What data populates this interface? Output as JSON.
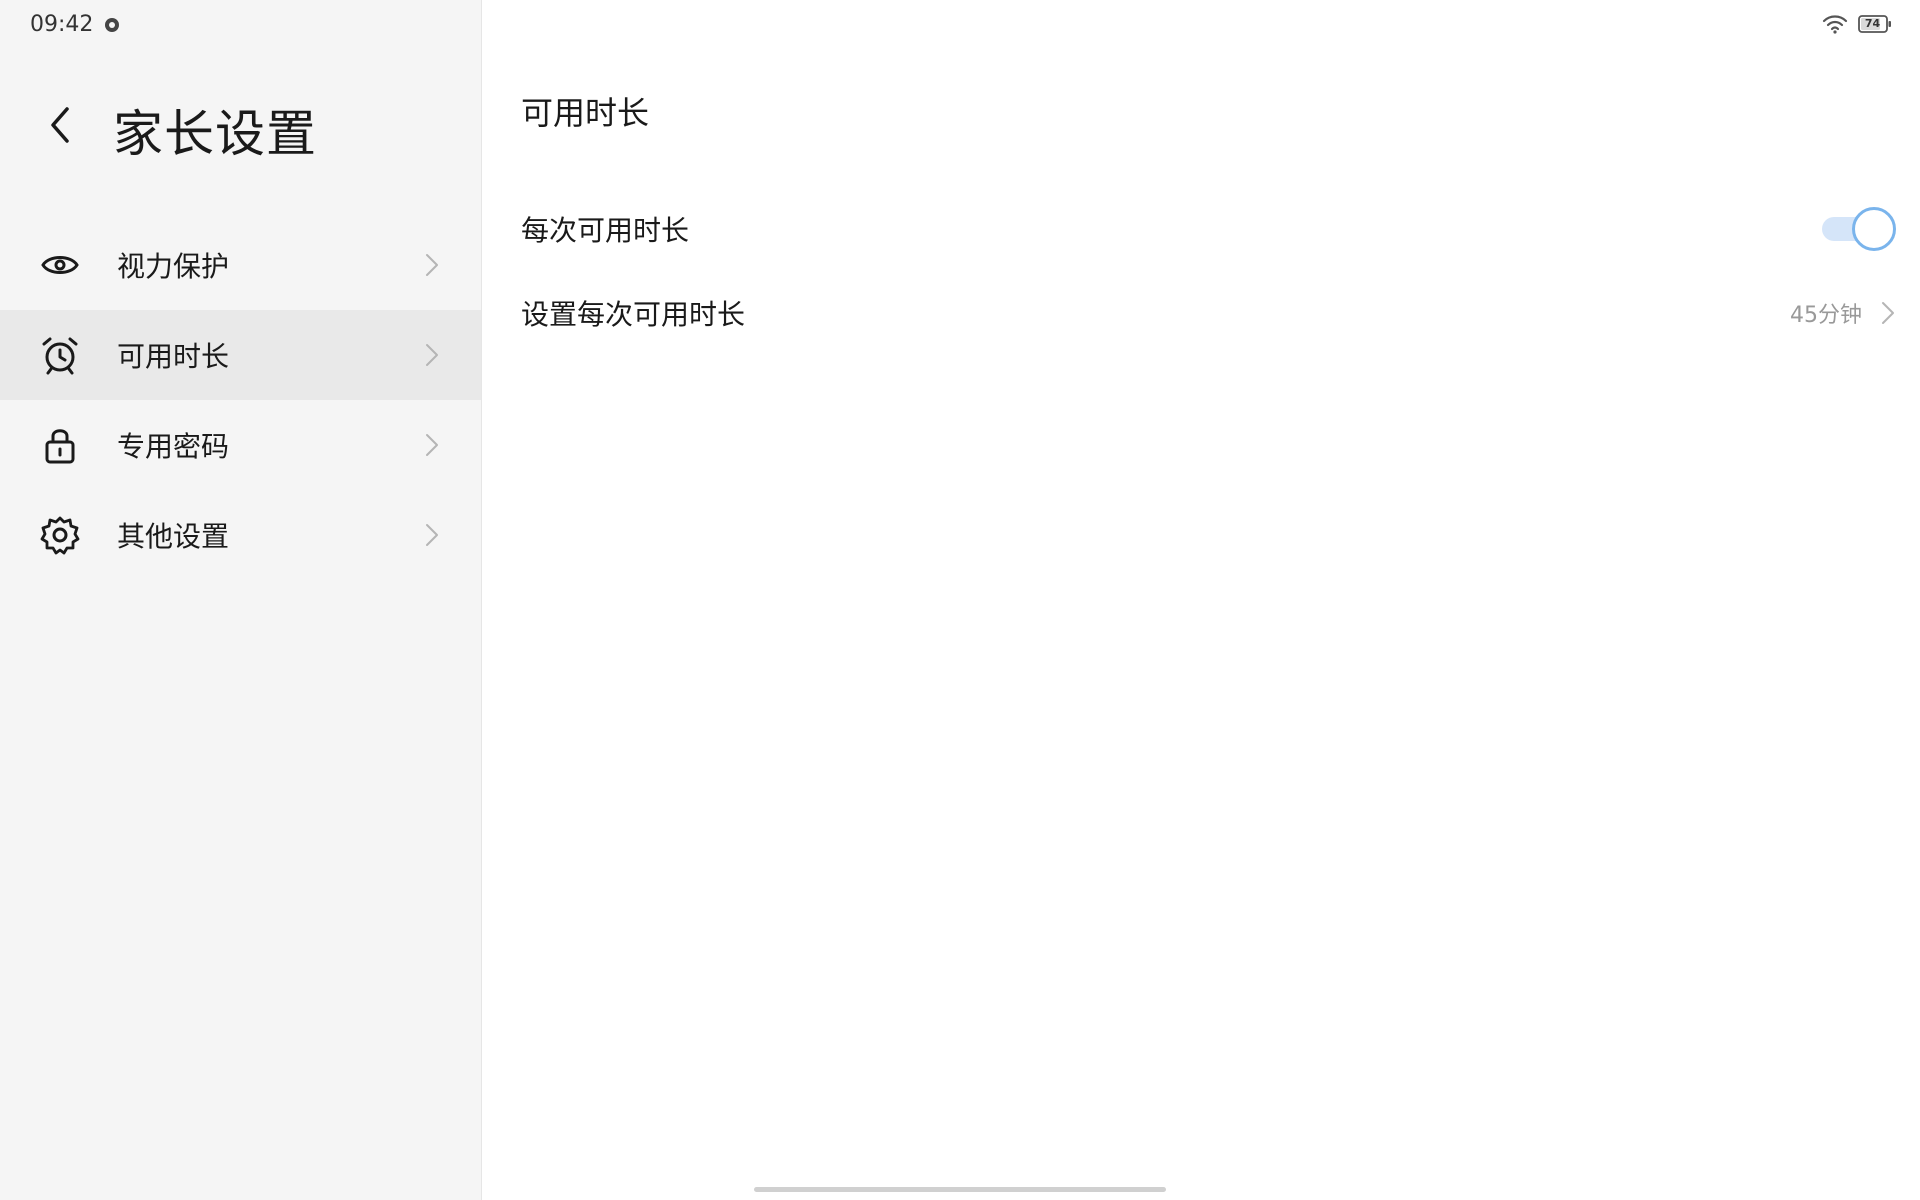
{
  "status_bar": {
    "time": "09:42",
    "battery": "74"
  },
  "sidebar": {
    "title": "家长设置",
    "items": [
      {
        "label": "视力保护",
        "icon": "eye-icon"
      },
      {
        "label": "可用时长",
        "icon": "alarm-clock-icon",
        "active": true
      },
      {
        "label": "专用密码",
        "icon": "lock-icon"
      },
      {
        "label": "其他设置",
        "icon": "gear-icon"
      }
    ]
  },
  "main": {
    "title": "可用时长",
    "rows": [
      {
        "label": "每次可用时长",
        "type": "toggle",
        "enabled": true
      },
      {
        "label": "设置每次可用时长",
        "type": "link",
        "value": "45分钟"
      }
    ]
  },
  "colors": {
    "toggle_accent": "#7ab4ec",
    "toggle_track": "#d5e5f9",
    "sidebar_bg": "#f5f5f5",
    "active_item_bg": "#e9e9e9"
  }
}
